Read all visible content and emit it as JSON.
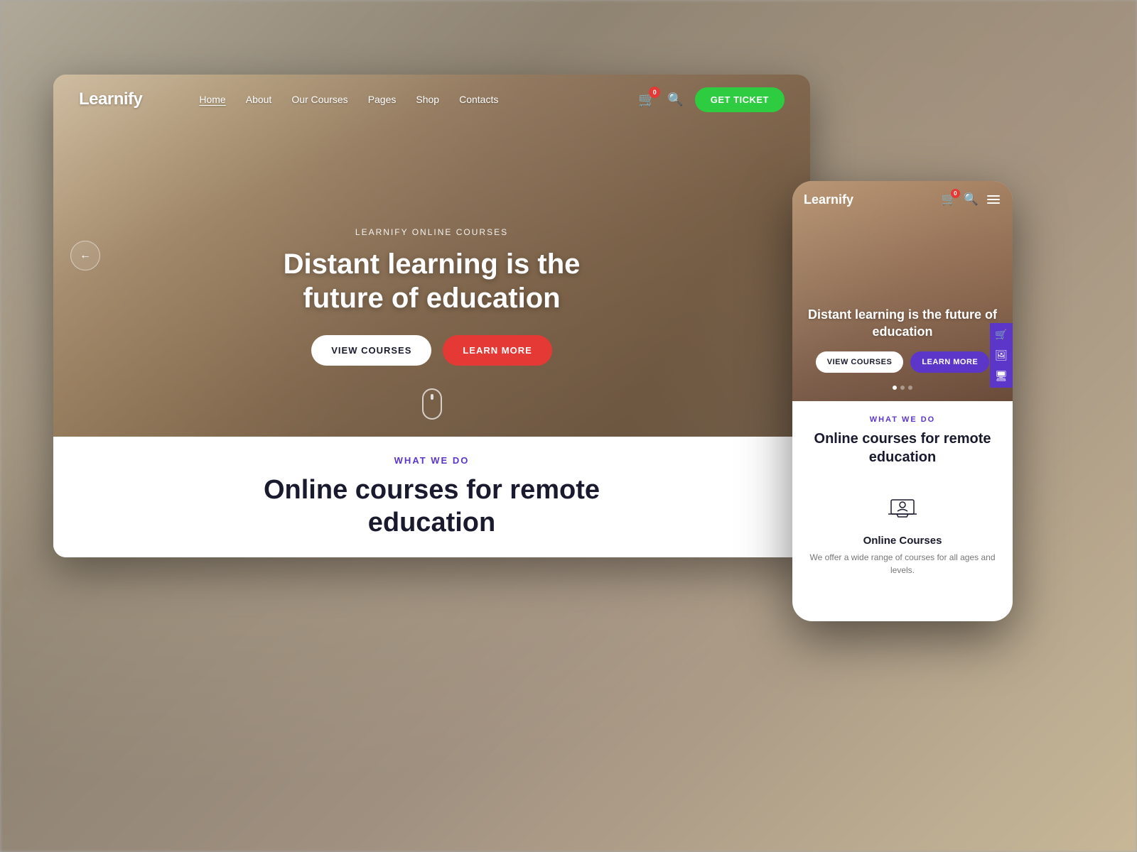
{
  "background": {
    "color": "#a0907a"
  },
  "desktop": {
    "nav": {
      "logo": "Learnify",
      "links": [
        {
          "label": "Home",
          "active": true
        },
        {
          "label": "About",
          "active": false
        },
        {
          "label": "Our Courses",
          "active": false
        },
        {
          "label": "Pages",
          "active": false
        },
        {
          "label": "Shop",
          "active": false
        },
        {
          "label": "Contacts",
          "active": false
        }
      ],
      "cart_badge": "0",
      "ticket_btn": "GET TICKET"
    },
    "hero": {
      "eyebrow": "LEARNIFY ONLINE COURSES",
      "title": "Distant learning is the future of education",
      "btn_courses": "VIEW COURSES",
      "btn_learn": "LEARN MORE"
    },
    "bottom": {
      "what_label": "WHAT WE DO",
      "title_line1": "Online courses for remote",
      "title_line2": "education"
    }
  },
  "mobile": {
    "logo": "Learnify",
    "cart_badge": "0",
    "hero": {
      "title": "Distant learning is the future of education",
      "btn_courses": "VIEW COURSES",
      "btn_learn": "LEARN MORE"
    },
    "bottom": {
      "what_label": "WHAT WE DO",
      "title": "Online courses for remote education",
      "course": {
        "title": "Online Courses",
        "description": "We offer a wide range of courses for all ages and levels."
      }
    }
  },
  "icons": {
    "cart": "🛒",
    "search": "🔍",
    "hamburger": "☰",
    "arrow_left": "←",
    "scroll": "scroll",
    "cart_side": "🛒",
    "image_side": "🖼",
    "monitor_side": "🖥"
  }
}
